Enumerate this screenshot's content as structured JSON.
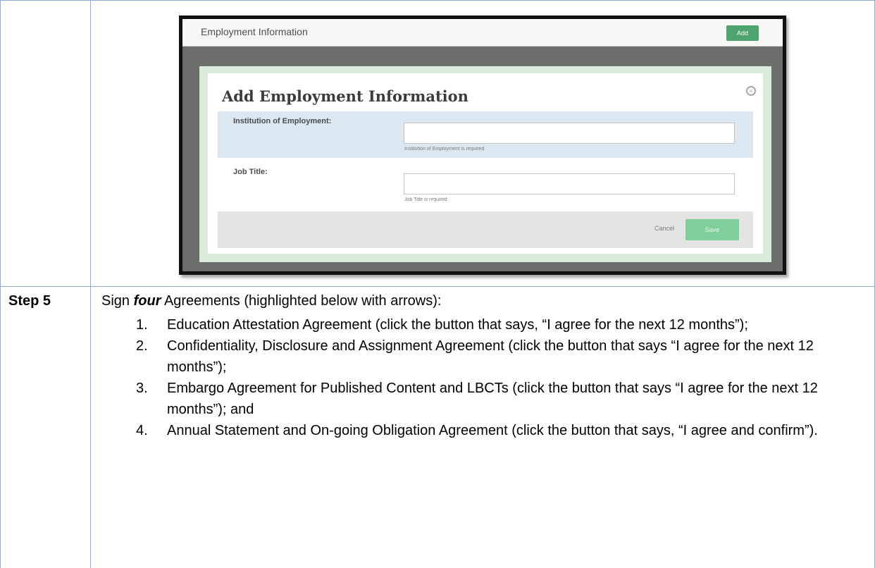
{
  "screenshot": {
    "header_title": "Employment Information",
    "add_button": "Add",
    "modal": {
      "title": "Add Employment Information",
      "fields": [
        {
          "label": "Institution of Employment:",
          "hint": "Institution of Employment is required"
        },
        {
          "label": "Job Title:",
          "hint": "Job Title is required"
        }
      ],
      "cancel": "Cancel",
      "save": "Save"
    }
  },
  "step": {
    "label": "Step 5",
    "intro_pre": "Sign ",
    "intro_em": "four",
    "intro_post": " Agreements (highlighted below with arrows):",
    "items": [
      {
        "num": "1.",
        "text": "Education Attestation Agreement (click the button that says, “I agree for the next 12 months”);"
      },
      {
        "num": "2.",
        "text": "Confidentiality, Disclosure and Assignment Agreement (click the button that says “I agree for the next 12 months”);"
      },
      {
        "num": "3.",
        "text": "Embargo Agreement for Published Content and LBCTs (click the button that says “I agree for the next 12 months”); and"
      },
      {
        "num": "4.",
        "text": "Annual Statement and On-going Obligation Agreement (click the button that says, “I agree and confirm”)."
      }
    ]
  }
}
